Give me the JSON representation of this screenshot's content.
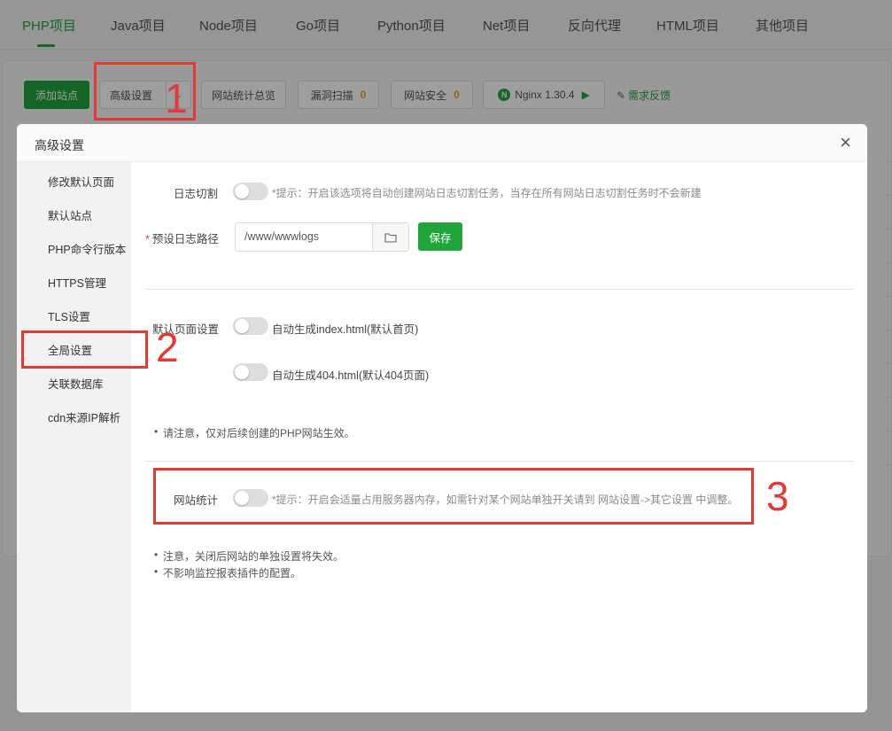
{
  "tabs": [
    "PHP项目",
    "Java项目",
    "Node项目",
    "Go项目",
    "Python项目",
    "Net项目",
    "反向代理",
    "HTML项目",
    "其他项目"
  ],
  "toolbar": {
    "add_site": "添加站点",
    "advanced": "高级设置",
    "site_stats": "网站统计总览",
    "vuln_scan": "漏洞扫描",
    "vuln_count": "0",
    "site_security": "网站安全",
    "security_count": "0",
    "nginx": "Nginx 1.30.4",
    "feedback": "需求反馈"
  },
  "modal": {
    "title": "高级设置",
    "close": "×",
    "sidebar": [
      "修改默认页面",
      "默认站点",
      "PHP命令行版本",
      "HTTPS管理",
      "TLS设置",
      "全局设置",
      "关联数据库",
      "cdn来源IP解析"
    ],
    "log_split_label": "日志切割",
    "log_split_hint": "*提示：开启该选项将自动创建网站日志切割任务，当存在所有网站日志切割任务时不会新建",
    "log_path_req": "*",
    "log_path_label": "预设日志路径",
    "log_path_value": "/www/wwwlogs",
    "save": "保存",
    "default_page_label": "默认页面设置",
    "auto_index": "自动生成index.html(默认首页)",
    "auto_404": "自动生成404.html(默认404页面)",
    "notice1": "请注意，仅对后续创建的PHP网站生效。",
    "site_stats_label": "网站统计",
    "site_stats_hint": "*提示：开启会适量占用服务器内存，如需针对某个网站单独开关请到 网站设置->其它设置 中调整。",
    "notice2": "注意，关闭后网站的单独设置将失效。",
    "notice3": "不影响监控报表插件的配置。"
  },
  "annotations": [
    "1",
    "2",
    "3"
  ]
}
